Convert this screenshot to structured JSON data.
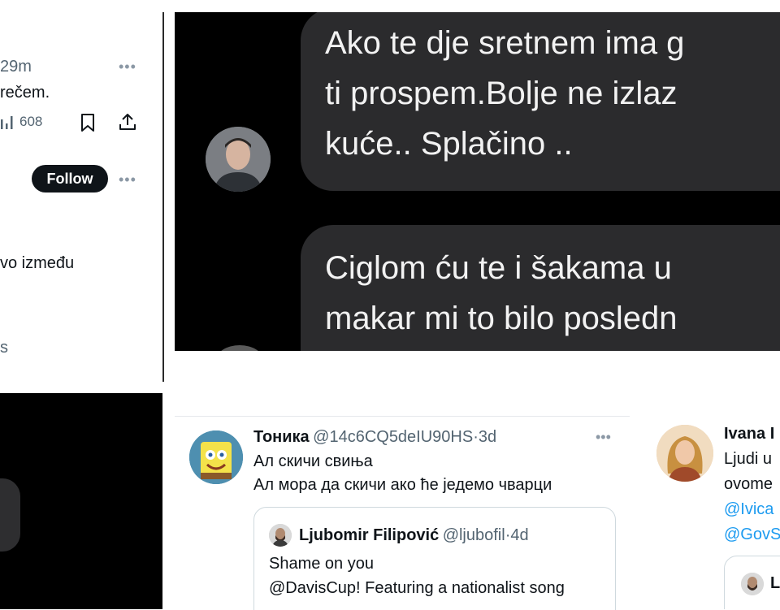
{
  "top_left": {
    "time": "29m",
    "text_line": "rečem.",
    "view_count": "608",
    "follow_label": "Follow",
    "snippet": "vo između",
    "tail": "s",
    "more_glyph": "•••"
  },
  "chat": {
    "message1_lines": [
      "Ako te dje sretnem ima g",
      "ti prospem.Bolje ne izlaz",
      "kuće.. Splačino .."
    ],
    "message2_lines": [
      "Ciglom ću te i šakama u",
      "makar mi to bilo posledn"
    ]
  },
  "tweet_main": {
    "name": "Тоника",
    "handle": "@14c6CQ5deIU90HS",
    "sep": "·",
    "age": "3d",
    "more_glyph": "•••",
    "lines": [
      "Ал скичи свиња",
      "Ал мора да скичи ако ће једемо чварци"
    ],
    "quote": {
      "name": "Ljubomir Filipović",
      "handle": "@ljubofil",
      "sep": "·",
      "age": "4d",
      "lines": [
        "Shame on you",
        "@DavisCup! Featuring a nationalist song"
      ]
    }
  },
  "tweet_right": {
    "name": "Ivana I",
    "lines": [
      "Ljudi u",
      "ovome"
    ],
    "links": [
      "@Ivica",
      "@GovS"
    ],
    "quote_initial": "L"
  },
  "colors": {
    "link": "#1d9bf0",
    "chat_bg": "#000000",
    "bubble": "#2b2b2d"
  }
}
